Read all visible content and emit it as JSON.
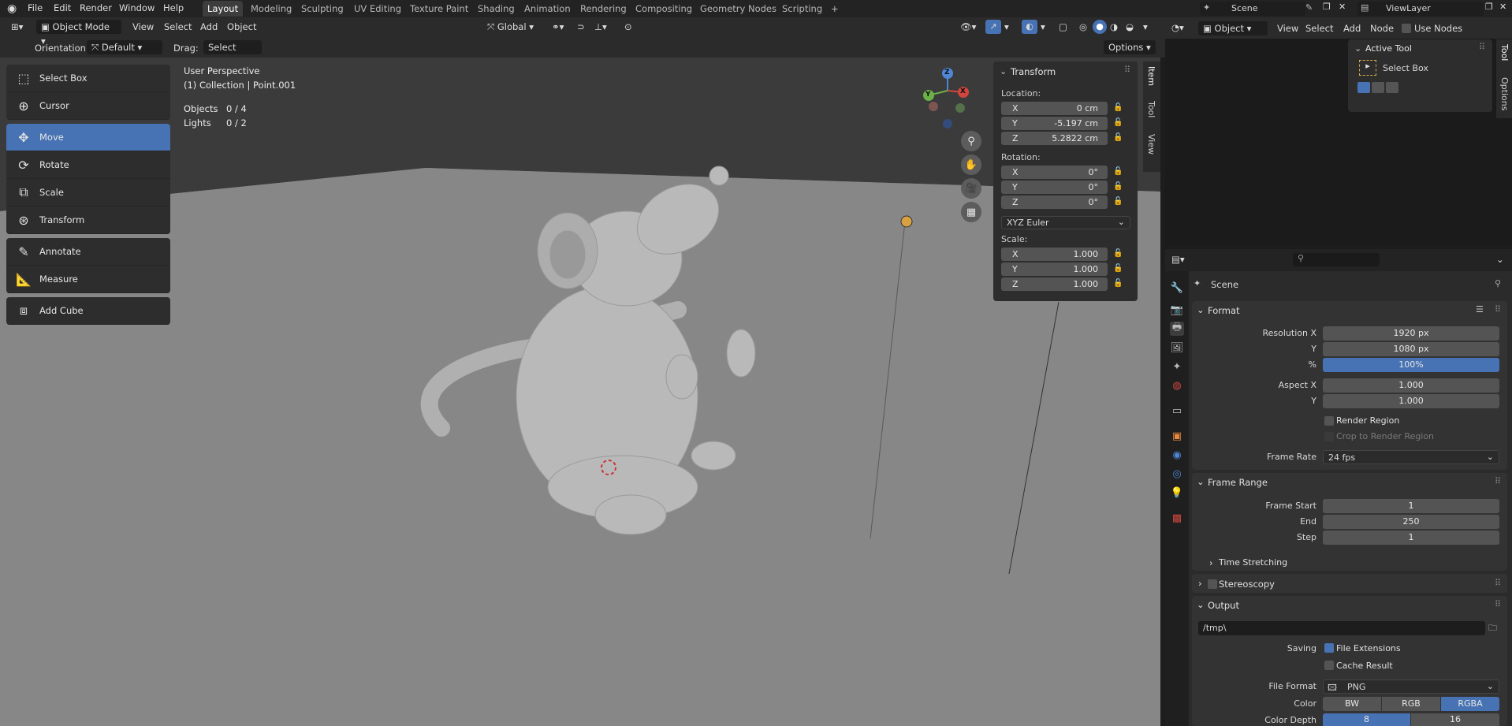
{
  "topbar": {
    "menus": [
      "File",
      "Edit",
      "Render",
      "Window",
      "Help"
    ],
    "workspaces": [
      "Layout",
      "Modeling",
      "Sculpting",
      "UV Editing",
      "Texture Paint",
      "Shading",
      "Animation",
      "Rendering",
      "Compositing",
      "Geometry Nodes",
      "Scripting"
    ],
    "active_workspace": "Layout",
    "add_tab": "+",
    "scene": "Scene",
    "view_layer": "ViewLayer"
  },
  "viewport_header": {
    "mode": "Object Mode",
    "menus": [
      "View",
      "Select",
      "Add",
      "Object"
    ],
    "transform_orientation": "Global",
    "orientation_label": "Orientation:",
    "orientation_value": "Default",
    "drag_label": "Drag:",
    "drag_value": "Select Box",
    "options": "Options"
  },
  "tools": {
    "groups": [
      [
        {
          "label": "Select Box",
          "icon": "select-box-icon"
        },
        {
          "label": "Cursor",
          "icon": "cursor-icon"
        }
      ],
      [
        {
          "label": "Move",
          "icon": "move-icon",
          "active": true
        },
        {
          "label": "Rotate",
          "icon": "rotate-icon"
        },
        {
          "label": "Scale",
          "icon": "scale-icon"
        },
        {
          "label": "Transform",
          "icon": "transform-icon"
        }
      ],
      [
        {
          "label": "Annotate",
          "icon": "annotate-icon"
        },
        {
          "label": "Measure",
          "icon": "measure-icon"
        }
      ],
      [
        {
          "label": "Add Cube",
          "icon": "add-cube-icon"
        }
      ]
    ]
  },
  "viewport_info": {
    "perspective": "User Perspective",
    "collection": "(1) Collection | Point.001",
    "objects_label": "Objects",
    "objects_value": "0 / 4",
    "lights_label": "Lights",
    "lights_value": "0 / 2"
  },
  "gizmo": {
    "x": "X",
    "y": "Y",
    "z": "Z"
  },
  "transform_panel": {
    "title": "Transform",
    "location_label": "Location:",
    "location": [
      {
        "axis": "X",
        "value": "0 cm"
      },
      {
        "axis": "Y",
        "value": "-5.197 cm"
      },
      {
        "axis": "Z",
        "value": "5.2822 cm"
      }
    ],
    "rotation_label": "Rotation:",
    "rotation": [
      {
        "axis": "X",
        "value": "0°"
      },
      {
        "axis": "Y",
        "value": "0°"
      },
      {
        "axis": "Z",
        "value": "0°"
      }
    ],
    "rotation_mode": "XYZ Euler",
    "scale_label": "Scale:",
    "scale": [
      {
        "axis": "X",
        "value": "1.000"
      },
      {
        "axis": "Y",
        "value": "1.000"
      },
      {
        "axis": "Z",
        "value": "1.000"
      }
    ]
  },
  "sidebar_tabs": [
    "Item",
    "Tool",
    "View"
  ],
  "node_editor": {
    "object": "Object",
    "menus": [
      "View",
      "Select",
      "Add",
      "Node"
    ],
    "use_nodes": "Use Nodes",
    "right_tabs": [
      "Tool",
      "Options"
    ],
    "active_tool_title": "Active Tool",
    "active_tool": "Select Box"
  },
  "properties": {
    "context": "Scene",
    "format": {
      "title": "Format",
      "resolution_x_label": "Resolution X",
      "resolution_x": "1920 px",
      "resolution_y_label": "Y",
      "resolution_y": "1080 px",
      "percent_label": "%",
      "percent": "100%",
      "aspect_x_label": "Aspect X",
      "aspect_x": "1.000",
      "aspect_y_label": "Y",
      "aspect_y": "1.000",
      "render_region": "Render Region",
      "crop_region": "Crop to Render Region",
      "frame_rate_label": "Frame Rate",
      "frame_rate": "24 fps"
    },
    "frame_range": {
      "title": "Frame Range",
      "start_label": "Frame Start",
      "start": "1",
      "end_label": "End",
      "end": "250",
      "step_label": "Step",
      "step": "1"
    },
    "time_stretching": "Time Stretching",
    "stereoscopy": "Stereoscopy",
    "output": {
      "title": "Output",
      "path": "/tmp\\",
      "saving_label": "Saving",
      "file_extensions": "File Extensions",
      "cache_result": "Cache Result",
      "file_format_label": "File Format",
      "file_format": "PNG",
      "color_label": "Color",
      "color_options": [
        "BW",
        "RGB",
        "RGBA"
      ],
      "color_selected": "RGBA",
      "depth_label": "Color Depth",
      "depth_options": [
        "8",
        "16"
      ],
      "depth_selected": "8"
    }
  },
  "colors": {
    "accent": "#4772b3",
    "viewport": "#7f7f7f",
    "panel": "#2d2d2d"
  }
}
